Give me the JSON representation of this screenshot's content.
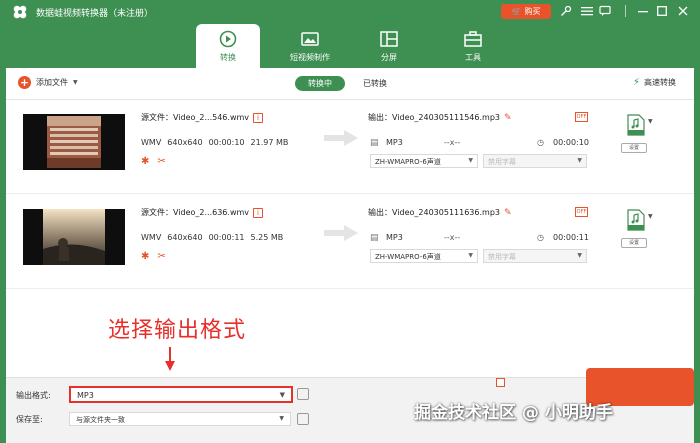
{
  "app": {
    "title": "数据蛙视频转换器（未注册）",
    "buy_label": "购买"
  },
  "main_tabs": [
    {
      "label": "转换",
      "active": true
    },
    {
      "label": "短视频制作",
      "active": false
    },
    {
      "label": "分屏",
      "active": false
    },
    {
      "label": "工具",
      "active": false
    }
  ],
  "toolbar": {
    "add_file_label": "添加文件",
    "seg_converting": "转换中",
    "seg_converted": "已转换",
    "fast_convert_label": "高速转换"
  },
  "files": [
    {
      "source_label": "源文件：Video_2...546.wmv",
      "format": "WMV",
      "resolution": "640x640",
      "duration": "00:00:10",
      "size": "21.97 MB",
      "output_label": "输出：Video_240305111546.mp3",
      "out_format": "MP3",
      "out_res": "--x--",
      "out_duration": "00:00:10",
      "audio_track": "ZH-WMAPRO-6声道",
      "subtitle": "禁用字幕",
      "out_badge": "OFF",
      "settings_label": "设置"
    },
    {
      "source_label": "源文件：Video_2...636.wmv",
      "format": "WMV",
      "resolution": "640x640",
      "duration": "00:00:11",
      "size": "5.25 MB",
      "output_label": "输出：Video_240305111636.mp3",
      "out_format": "MP3",
      "out_res": "--x--",
      "out_duration": "00:00:11",
      "audio_track": "ZH-WMAPRO-6声道",
      "subtitle": "禁用字幕",
      "out_badge": "OFF",
      "settings_label": "设置"
    }
  ],
  "annotation": {
    "text": "选择输出格式"
  },
  "bottom": {
    "output_format_label": "输出格式:",
    "output_format_value": "MP3",
    "save_to_label": "保存至:",
    "save_to_value": "与源文件夹一致"
  },
  "watermark": "掘金技术社区 @ 小明助手",
  "colors": {
    "brand_green": "#3d8f52",
    "accent_orange": "#e8532b",
    "annotation_red": "#e8302b"
  }
}
